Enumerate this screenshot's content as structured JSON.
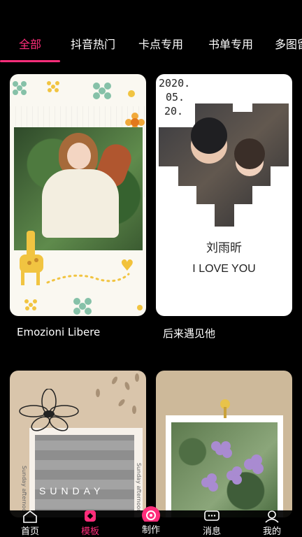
{
  "tabs": [
    {
      "label": "全部",
      "active": true
    },
    {
      "label": "抖音热门",
      "active": false
    },
    {
      "label": "卡点专用",
      "active": false
    },
    {
      "label": "书单专用",
      "active": false
    },
    {
      "label": "多图留",
      "active": false
    }
  ],
  "accent_color": "#ff2d7a",
  "templates": [
    {
      "title": "Emozioni Libere"
    },
    {
      "title": "后来遇见他",
      "date_lines": [
        "2020.",
        "05.",
        "20."
      ],
      "name": "刘雨昕",
      "tagline": "I LOVE YOU"
    },
    {
      "title": "",
      "text": "SUNDAY",
      "side_text": "Sunday afternoon"
    },
    {
      "title": ""
    }
  ],
  "bottom_nav": [
    {
      "label": "首页",
      "icon": "home-icon",
      "active": false
    },
    {
      "label": "模板",
      "icon": "template-icon",
      "active": true
    },
    {
      "label": "制作",
      "icon": "create-icon",
      "active": false
    },
    {
      "label": "消息",
      "icon": "message-icon",
      "active": false
    },
    {
      "label": "我的",
      "icon": "profile-icon",
      "active": false
    }
  ]
}
